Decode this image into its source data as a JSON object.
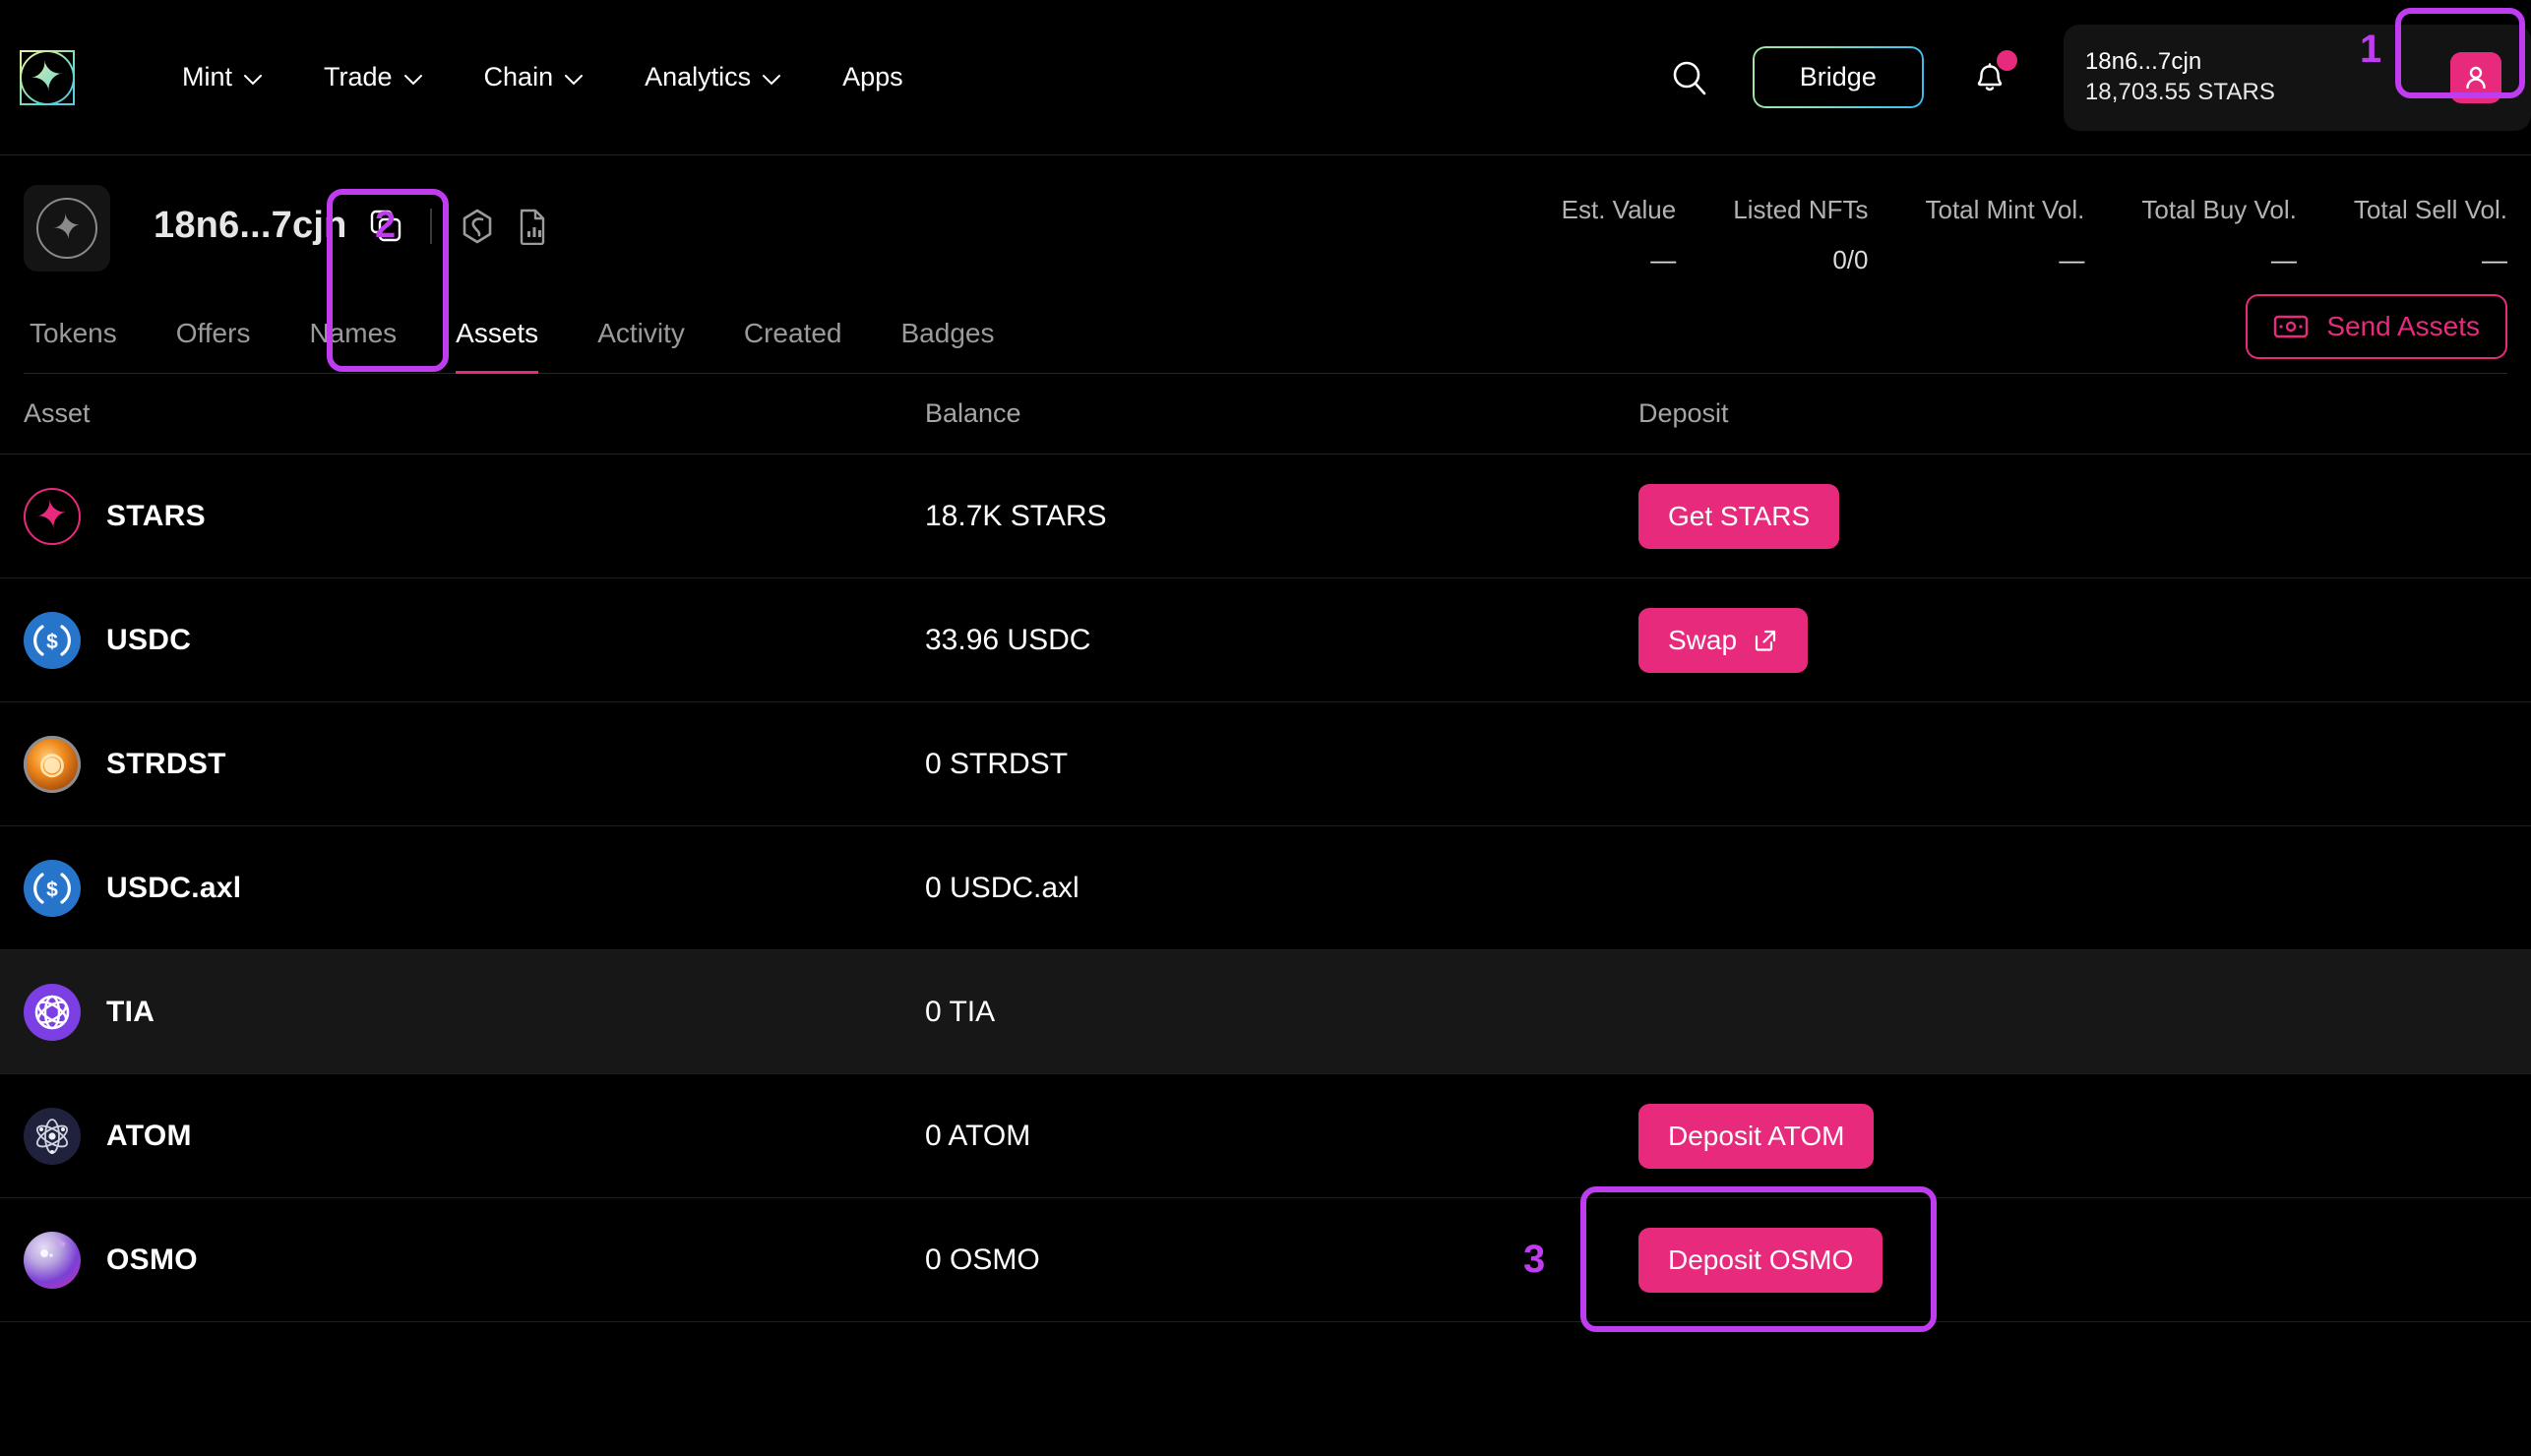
{
  "nav": {
    "logo_icon": "starglaze-logo-icon",
    "items": [
      {
        "label": "Mint",
        "has_caret": true
      },
      {
        "label": "Trade",
        "has_caret": true
      },
      {
        "label": "Chain",
        "has_caret": true
      },
      {
        "label": "Analytics",
        "has_caret": true
      },
      {
        "label": "Apps",
        "has_caret": false
      }
    ],
    "search_icon": "search-icon",
    "bridge_label": "Bridge",
    "bell_icon": "bell-icon",
    "has_notification": true,
    "wallet": {
      "address": "18n6...7cjn",
      "balance": "18,703.55 STARS",
      "avatar_icon": "user-icon"
    }
  },
  "profile": {
    "avatar_icon": "star-avatar-icon",
    "address": "18n6...7cjn",
    "actions": [
      {
        "icon": "copy-icon",
        "name": "copy-address-button"
      },
      {
        "icon": "hexagon-link-icon",
        "name": "explorer-link-button"
      },
      {
        "icon": "document-chart-icon",
        "name": "report-button"
      }
    ],
    "stats": [
      {
        "label": "Est. Value",
        "value": "—"
      },
      {
        "label": "Listed NFTs",
        "value": "0/0"
      },
      {
        "label": "Total Mint Vol.",
        "value": "—"
      },
      {
        "label": "Total Buy Vol.",
        "value": "—"
      },
      {
        "label": "Total Sell Vol.",
        "value": "—"
      }
    ]
  },
  "tabs": [
    {
      "label": "Tokens",
      "active": false
    },
    {
      "label": "Offers",
      "active": false
    },
    {
      "label": "Names",
      "active": false
    },
    {
      "label": "Assets",
      "active": true
    },
    {
      "label": "Activity",
      "active": false
    },
    {
      "label": "Created",
      "active": false
    },
    {
      "label": "Badges",
      "active": false
    }
  ],
  "send_assets": {
    "label": "Send Assets",
    "icon": "banknote-icon"
  },
  "table": {
    "columns": [
      "Asset",
      "Balance",
      "Deposit"
    ],
    "rows": [
      {
        "asset": "STARS",
        "coin": "coin-stars",
        "balance": "18.7K STARS",
        "action": "Get STARS",
        "action_icon": null,
        "hover": false
      },
      {
        "asset": "USDC",
        "coin": "coin-usdc",
        "balance": "33.96 USDC",
        "action": "Swap",
        "action_icon": "external-link-icon",
        "hover": false
      },
      {
        "asset": "STRDST",
        "coin": "coin-strdst",
        "balance": "0 STRDST",
        "action": null,
        "action_icon": null,
        "hover": false
      },
      {
        "asset": "USDC.axl",
        "coin": "coin-usdc",
        "balance": "0 USDC.axl",
        "action": null,
        "action_icon": null,
        "hover": false
      },
      {
        "asset": "TIA",
        "coin": "coin-tia",
        "balance": "0 TIA",
        "action": null,
        "action_icon": null,
        "hover": true
      },
      {
        "asset": "ATOM",
        "coin": "coin-atom",
        "balance": "0 ATOM",
        "action": "Deposit ATOM",
        "action_icon": null,
        "hover": false
      },
      {
        "asset": "OSMO",
        "coin": "coin-osmo",
        "balance": "0 OSMO",
        "action": "Deposit OSMO",
        "action_icon": null,
        "hover": false
      }
    ]
  },
  "annotations": [
    {
      "number": "1",
      "target": "wallet-avatar-button"
    },
    {
      "number": "2",
      "target": "tab-assets"
    },
    {
      "number": "3",
      "target": "deposit-osmo-button"
    }
  ],
  "colors": {
    "accent_pink": "#e72a7c",
    "annotation_purple": "#bf3cf0",
    "background": "#000000",
    "row_hover": "#171717"
  }
}
